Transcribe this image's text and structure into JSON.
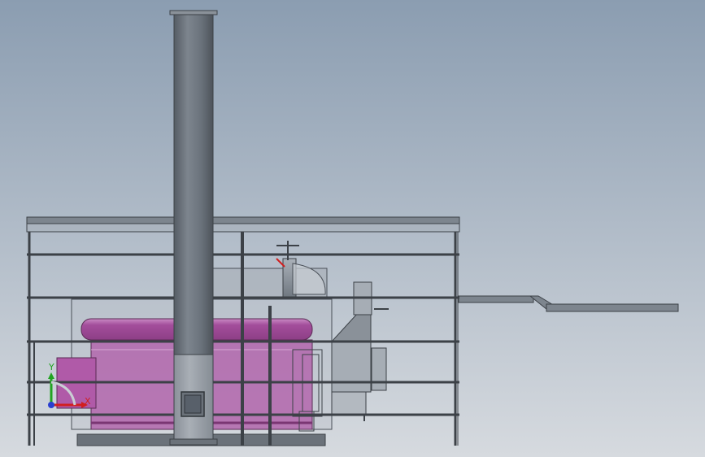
{
  "viewport": {
    "background_top": "#8b9db1",
    "background_bottom": "#d6dadf"
  },
  "colors": {
    "steel": "#6f7882",
    "steel_light": "#a6adb5",
    "steel_dark": "#4a5058",
    "frame": "#3c4147",
    "boiler_magenta": "#b05aa8",
    "boiler_magenta_light": "#d08fcb",
    "glass": "#c7cdd3",
    "axis_x": "#d11f1f",
    "axis_y": "#21a321",
    "axis_z": "#2a3fd0"
  },
  "triad": {
    "x_label": "X",
    "y_label": "Y",
    "icon": "coordinate-triad-icon"
  }
}
